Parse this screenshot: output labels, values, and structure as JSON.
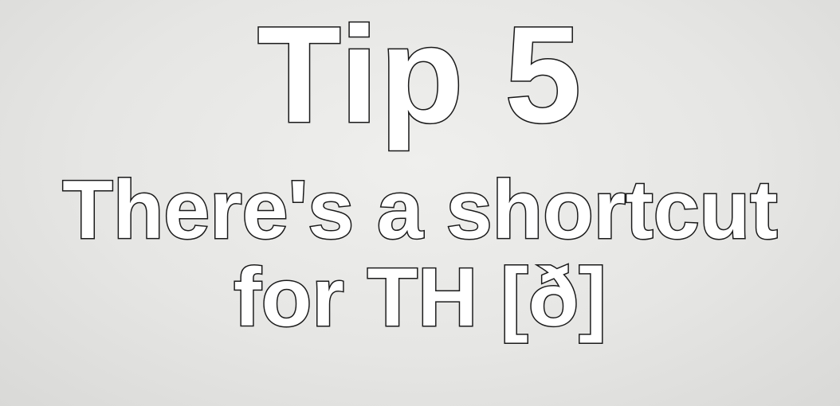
{
  "slide": {
    "title": "Tip 5",
    "subtitle_line1": "There's a shortcut",
    "subtitle_line2": "for TH [ð]"
  },
  "colors": {
    "background": "#e6e6e4",
    "text_fill": "#ffffff",
    "text_outline": "#1a1a1a"
  }
}
